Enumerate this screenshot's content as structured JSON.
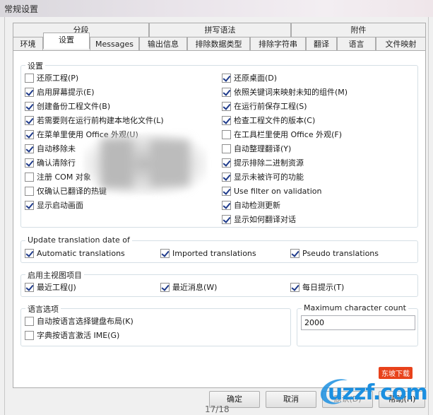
{
  "window": {
    "title": "常规设置"
  },
  "tabs_row1": [
    {
      "label": "分段"
    },
    {
      "label": "拼写语法"
    },
    {
      "label": "附件"
    }
  ],
  "tabs_row2": [
    {
      "label": "环境"
    },
    {
      "label": "设置",
      "active": true
    },
    {
      "label": "Messages"
    },
    {
      "label": "输出信息"
    },
    {
      "label": "排除数据类型"
    },
    {
      "label": "排除字符串"
    },
    {
      "label": "翻译"
    },
    {
      "label": "语言"
    },
    {
      "label": "文件映射"
    }
  ],
  "settings": {
    "title": "设置",
    "left": [
      {
        "label": "还原工程(P)",
        "checked": false
      },
      {
        "label": "启用屏幕提示(E)",
        "checked": true
      },
      {
        "label": "创建备份工程文件(B)",
        "checked": true
      },
      {
        "label": "若需要则在运行前构建本地化文件(L)",
        "checked": true
      },
      {
        "label": "在菜单里使用 Office 外观(U)",
        "checked": true
      },
      {
        "label": "自动移除未",
        "checked": true
      },
      {
        "label": "确认清除行",
        "checked": true
      },
      {
        "label": "注册 COM 对象",
        "checked": false
      },
      {
        "label": "仅确认已翻译的热键",
        "checked": false
      },
      {
        "label": "显示启动画面",
        "checked": true
      }
    ],
    "right": [
      {
        "label": "还原桌面(D)",
        "checked": true
      },
      {
        "label": "依照关键词来映射未知的组件(M)",
        "checked": true
      },
      {
        "label": "在运行前保存工程(S)",
        "checked": true
      },
      {
        "label": "检查工程文件的版本(C)",
        "checked": true
      },
      {
        "label": "在工具栏里使用 Office 外观(F)",
        "checked": false
      },
      {
        "label": "自动整理翻译(Y)",
        "checked": false
      },
      {
        "label": "提示排除二进制资源",
        "checked": true
      },
      {
        "label": "显示未被许可的功能",
        "checked": true
      },
      {
        "label": "Use filter on validation",
        "checked": true
      },
      {
        "label": "自动检测更新",
        "checked": true
      },
      {
        "label": "显示如何翻译对话",
        "checked": true
      }
    ]
  },
  "update_translation": {
    "title": "Update translation date of",
    "items": [
      {
        "label": "Automatic translations",
        "checked": true
      },
      {
        "label": "Imported translations",
        "checked": true
      },
      {
        "label": "Pseudo translations",
        "checked": true
      }
    ]
  },
  "main_view": {
    "title": "启用主视图项目",
    "items": [
      {
        "label": "最近工程(J)",
        "checked": true
      },
      {
        "label": "最近消息(W)",
        "checked": true
      },
      {
        "label": "每日提示(T)",
        "checked": true
      }
    ]
  },
  "language_options": {
    "title": "语言选项",
    "items": [
      {
        "label": "自动按语言选择键盘布局(K)",
        "checked": false
      },
      {
        "label": "字典按语言激活 IME(G)",
        "checked": false
      }
    ]
  },
  "max_char": {
    "title": "Maximum character count",
    "value": "2000"
  },
  "buttons": {
    "ok": "确定",
    "cancel": "取消",
    "default": "默认(D)",
    "help": "帮助(H)"
  },
  "pager": "17/18",
  "watermark": {
    "text": "uzzf.com",
    "badge": "东坡下载"
  }
}
